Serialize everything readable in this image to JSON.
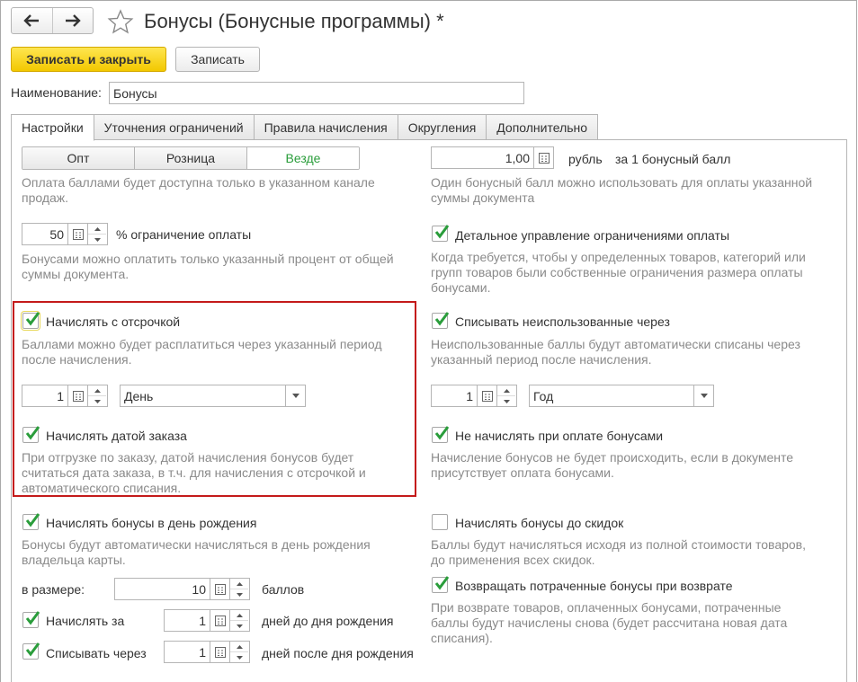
{
  "header": {
    "title": "Бонусы (Бонусные программы) *",
    "back_icon": "arrow-left-icon",
    "forward_icon": "arrow-right-icon",
    "favorite_icon": "star-icon"
  },
  "toolbar": {
    "save_close": "Записать и закрыть",
    "save": "Записать"
  },
  "name": {
    "label": "Наименование:",
    "value": "Бонусы"
  },
  "tabs": [
    "Настройки",
    "Уточнения ограничений",
    "Правила начисления",
    "Округления",
    "Дополнительно"
  ],
  "active_tab": "Настройки",
  "colors": {
    "accent_green": "#2a9d3b",
    "primary_button": "#f2c800",
    "highlight_border": "#c41a1a",
    "hint_text": "#8a8a8a"
  },
  "left": {
    "channel": {
      "options": [
        "Опт",
        "Розница",
        "Везде"
      ],
      "selected": "Везде",
      "hint": [
        "Оплата баллами будет доступна только в указанном канале",
        "продаж."
      ]
    },
    "limit": {
      "value": "50",
      "label": "% ограничение оплаты",
      "hint": [
        "Бонусами можно оплатить только указанный процент от общей",
        "суммы документа."
      ]
    },
    "defer": {
      "checked": true,
      "label": "Начислять с отсрочкой",
      "hint": [
        "Баллами можно будет расплатиться через указанный период",
        "после начисления."
      ],
      "count": "1",
      "period": "День"
    },
    "order_date": {
      "checked": true,
      "label": "Начислять датой заказа",
      "hint": [
        "При отгрузке по заказу, датой начисления бонусов будет",
        "считаться дата заказа, в т.ч. для начисления с отсрочкой и",
        "автоматического списания."
      ]
    },
    "birthday": {
      "checked": true,
      "label": "Начислять бонусы в день рождения",
      "hint": [
        "Бонусы будут автоматически начисляться в день рождения",
        "владельца карты."
      ],
      "amount_label": "в размере:",
      "amount": "10",
      "amount_unit": "баллов",
      "before": {
        "checked": true,
        "label": "Начислять за",
        "value": "1",
        "unit": "дней до дня рождения"
      },
      "after": {
        "checked": true,
        "label": "Списывать через",
        "value": "1",
        "unit": "дней после дня рождения"
      }
    }
  },
  "right": {
    "rate": {
      "value": "1,00",
      "currency": "рубль",
      "label": "за 1 бонусный балл",
      "hint": [
        "Один бонусный балл можно использовать для оплаты указанной",
        "суммы документа"
      ]
    },
    "detailed": {
      "checked": true,
      "label": "Детальное управление ограничениями оплаты",
      "hint": [
        "Когда требуется, чтобы у определенных товаров, категорий или",
        "групп товаров были собственные ограничения размера оплаты",
        "бонусами."
      ]
    },
    "expire": {
      "checked": true,
      "label": "Списывать неиспользованные через",
      "hint": [
        "Неиспользованные баллы будут автоматически списаны через",
        "указанный период после начисления."
      ],
      "count": "1",
      "period": "Год"
    },
    "no_accrual": {
      "checked": true,
      "label": "Не начислять при оплате бонусами",
      "hint": [
        "Начисление бонусов не будет происходить, если в документе",
        "присутствует оплата бонусами."
      ]
    },
    "before_discount": {
      "checked": false,
      "label": "Начислять бонусы до скидок",
      "hint": [
        "Баллы будут начисляться исходя из полной стоимости товаров,",
        "до применения всех скидок."
      ]
    },
    "refund": {
      "checked": true,
      "label": "Возвращать потраченные бонусы при возврате",
      "hint": [
        "При возврате товаров, оплаченных бонусами, потраченные",
        "баллы будут начислены снова (будет рассчитана новая дата",
        "списания)."
      ]
    }
  }
}
